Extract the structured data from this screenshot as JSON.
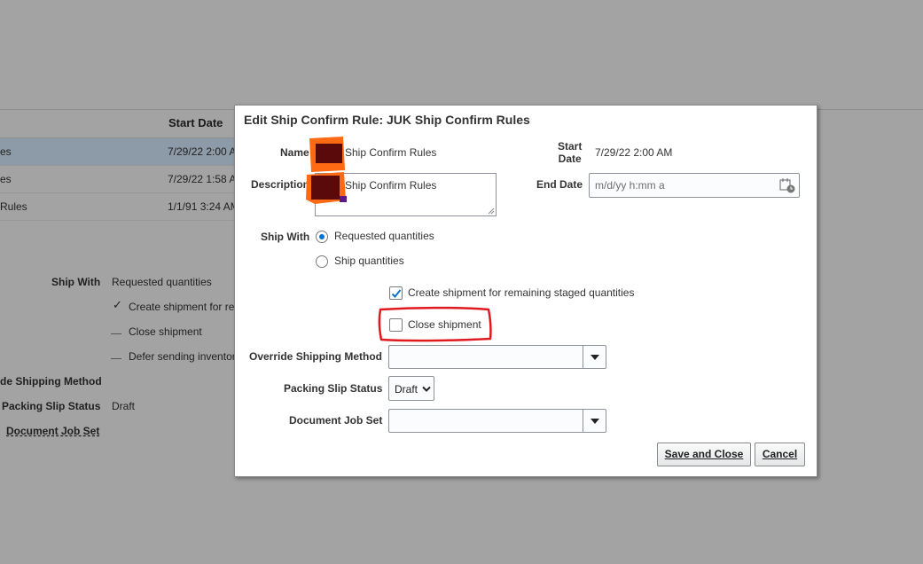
{
  "background": {
    "table": {
      "header_start_date": "Start Date",
      "rows": [
        {
          "name": "es",
          "start": "7/29/22 2:00 A"
        },
        {
          "name": "es",
          "start": "7/29/22 1:58 A"
        },
        {
          "name": "Rules",
          "start": "1/1/91 3:24 AM"
        }
      ]
    },
    "details": {
      "ship_with_label": "Ship With",
      "ship_with_value": "Requested quantities",
      "create_shipment": "Create shipment for re",
      "close_shipment": "Close shipment",
      "defer_sending": "Defer sending inventor",
      "override_label": "de Shipping Method",
      "packing_label": "Packing Slip Status",
      "packing_value": "Draft",
      "doc_job_set_label": "Document Job Set"
    }
  },
  "dialog": {
    "title": "Edit Ship Confirm Rule: JUK Ship Confirm Rules",
    "name_label": "Name",
    "name_value": "Ship Confirm Rules",
    "description_label": "Description",
    "description_value": "Ship Confirm Rules",
    "start_date_label_1": "Start",
    "start_date_label_2": "Date",
    "start_date_value": "7/29/22 2:00 AM",
    "end_date_label": "End Date",
    "end_date_placeholder": "m/d/yy h:mm a",
    "ship_with_label": "Ship With",
    "ship_with_options": [
      {
        "label": "Requested quantities",
        "selected": true
      },
      {
        "label": "Ship quantities",
        "selected": false
      }
    ],
    "create_shipment_label": "Create shipment for remaining staged quantities",
    "create_shipment_checked": true,
    "close_shipment_label": "Close shipment",
    "close_shipment_checked": false,
    "override_label": "Override Shipping Method",
    "override_value": "",
    "packing_slip_label": "Packing Slip Status",
    "packing_slip_value": "Draft",
    "document_job_set_label": "Document Job Set",
    "document_job_set_value": "",
    "save_label": "Save and Close",
    "cancel_label": "Cancel"
  },
  "colors": {
    "overlay": "#a3a3a3",
    "selected_row": "#8d9aa7",
    "accent": "#0572ce",
    "annotation": "#e0191f",
    "redaction_orange": "#ff6a13",
    "redaction_dark": "#5a0a0a"
  }
}
